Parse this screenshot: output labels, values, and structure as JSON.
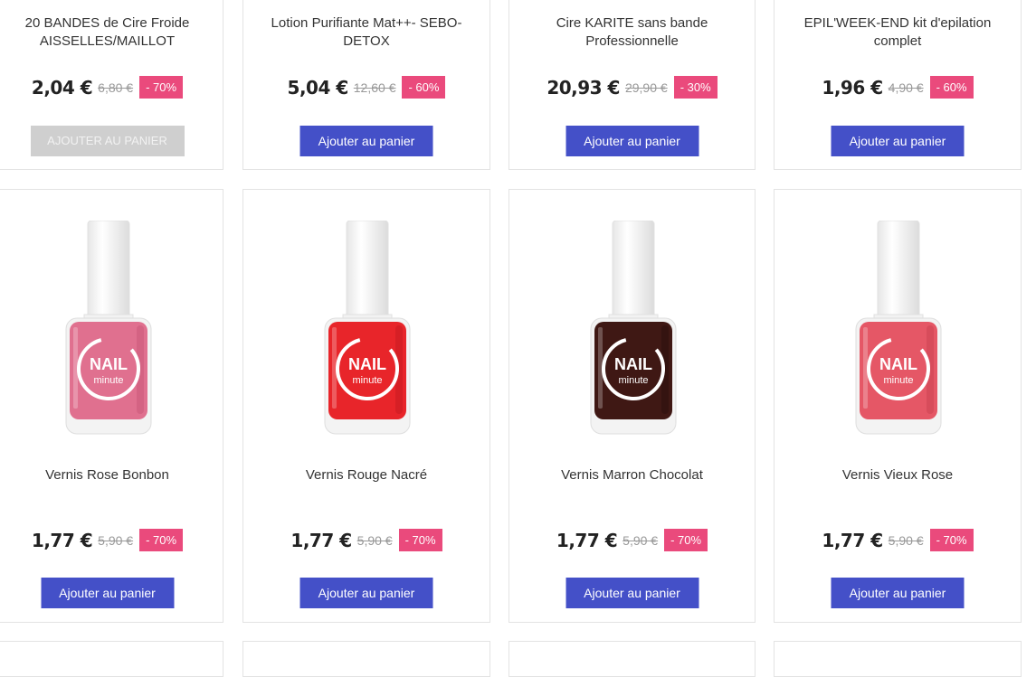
{
  "top_products": [
    {
      "title": "20 BANDES de Cire Froide AISSELLES/MAILLOT",
      "price": "2,04 €",
      "old_price": "6,80 €",
      "discount": "- 70%",
      "button": "AJOUTER AU PANIER",
      "disabled": true
    },
    {
      "title": "Lotion Purifiante Mat++- SEBO-DETOX",
      "price": "5,04 €",
      "old_price": "12,60 €",
      "discount": "- 60%",
      "button": "Ajouter au panier",
      "disabled": false
    },
    {
      "title": "Cire KARITE sans bande Professionnelle",
      "price": "20,93 €",
      "old_price": "29,90 €",
      "discount": "- 30%",
      "button": "Ajouter au panier",
      "disabled": false
    },
    {
      "title": "EPIL'WEEK-END kit d'epilation complet",
      "price": "1,96 €",
      "old_price": "4,90 €",
      "discount": "- 60%",
      "button": "Ajouter au panier",
      "disabled": false
    }
  ],
  "nail_products": [
    {
      "title": "Vernis Rose Bonbon",
      "price": "1,77 €",
      "old_price": "5,90 €",
      "discount": "- 70%",
      "button": "Ajouter au panier",
      "color": "#e0708f",
      "color_dark": "#c85577",
      "label_top": "NAIL",
      "label_bottom": "minute"
    },
    {
      "title": "Vernis Rouge Nacré",
      "price": "1,77 €",
      "old_price": "5,90 €",
      "discount": "- 70%",
      "button": "Ajouter au panier",
      "color": "#e8252a",
      "color_dark": "#c41a1f",
      "label_top": "NAIL",
      "label_bottom": "minute"
    },
    {
      "title": "Vernis Marron Chocolat",
      "price": "1,77 €",
      "old_price": "5,90 €",
      "discount": "- 70%",
      "button": "Ajouter au panier",
      "color": "#3f1814",
      "color_dark": "#2a0e0b",
      "label_top": "NAIL",
      "label_bottom": "minute"
    },
    {
      "title": "Vernis Vieux Rose",
      "price": "1,77 €",
      "old_price": "5,90 €",
      "discount": "- 70%",
      "button": "Ajouter au panier",
      "color": "#e55766",
      "color_dark": "#c9424f",
      "label_top": "NAIL",
      "label_bottom": "minute"
    }
  ]
}
